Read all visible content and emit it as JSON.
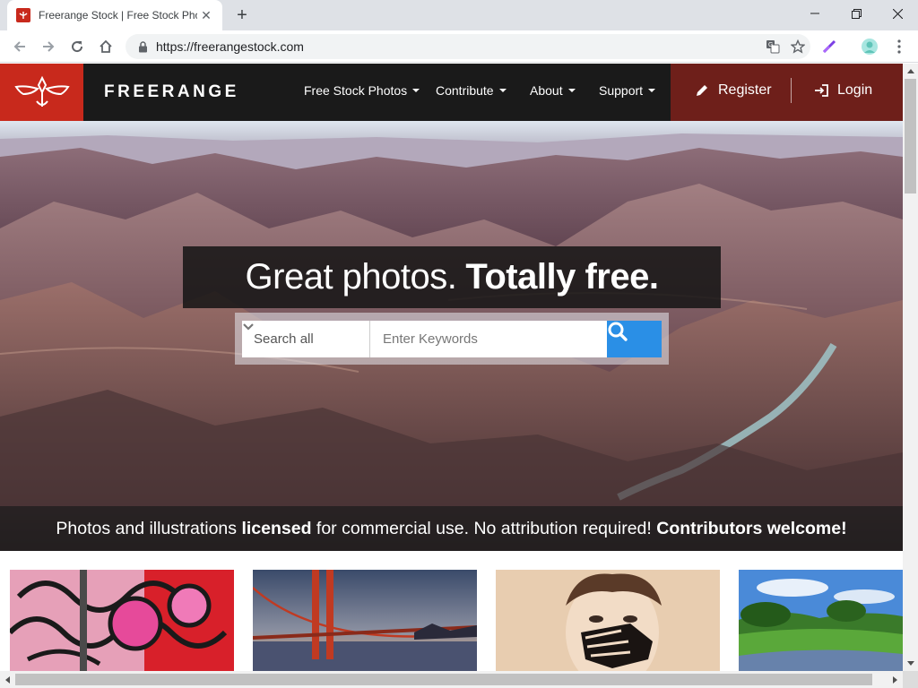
{
  "browser": {
    "tab_title": "Freerange Stock | Free Stock Photos",
    "url": "https://freerangestock.com"
  },
  "site": {
    "brand": "FREERANGE",
    "nav": [
      {
        "label": "Free Stock Photos"
      },
      {
        "label": "Contribute"
      },
      {
        "label": "About"
      },
      {
        "label": "Support"
      }
    ],
    "register_label": "Register",
    "login_label": "Login"
  },
  "hero": {
    "headline_regular": "Great photos.",
    "headline_bold": "Totally free.",
    "search_select_value": "Search all",
    "search_placeholder": "Enter Keywords",
    "tagline_part1": "Photos and illustrations ",
    "tagline_bold1": "licensed",
    "tagline_part2": " for commercial use. No attribution required! ",
    "tagline_bold2": "Contributors welcome!"
  },
  "thumbnails": [
    {
      "subject": "graffiti"
    },
    {
      "subject": "golden gate bridge"
    },
    {
      "subject": "face with handprint"
    },
    {
      "subject": "green meadow"
    }
  ],
  "colors": {
    "brand_red": "#c8291c",
    "auth_bg": "#6e1f1a",
    "header_bg": "#1a1a1a",
    "search_button": "#2a8fe6"
  }
}
